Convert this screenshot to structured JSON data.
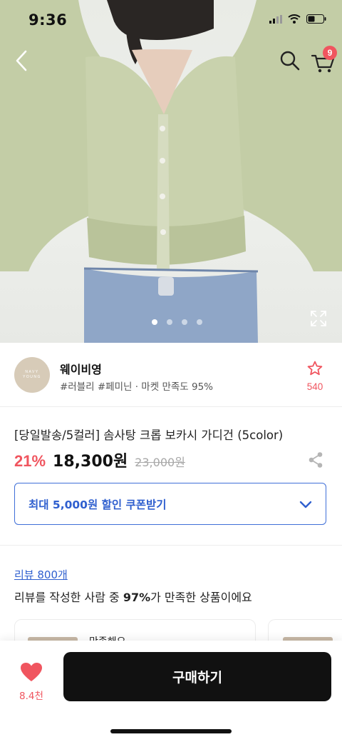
{
  "status_bar": {
    "time": "9:36"
  },
  "header": {
    "cart_count": "9"
  },
  "gallery": {
    "page_count": 4,
    "active_index": 0
  },
  "store": {
    "logo_text_line1": "NAVY",
    "logo_text_line2": "YOUNG",
    "name": "웨이비영",
    "tags": "#러블리 #페미닌 · 마켓 만족도 95%",
    "favorite_count": "540"
  },
  "product": {
    "title": "[당일발송/5컬러] 솜사탕 크롭 보카시 가디건 (5color)",
    "discount": "21%",
    "price": "18,300원",
    "original_price": "23,000원"
  },
  "coupon": {
    "label": "최대 5,000원 할인 쿠폰받기"
  },
  "reviews": {
    "link": "리뷰 800개",
    "summary_prefix": "리뷰를 작성한 사람 중 ",
    "summary_percent": "97%",
    "summary_suffix": "가 만족한 상품이에요",
    "card_text": "만족해요"
  },
  "bottom_bar": {
    "like_count": "8.4천",
    "buy_label": "구매하기"
  },
  "colors": {
    "accent_red": "#f0555f",
    "link_blue": "#2f5fcf",
    "buy_button": "#111111"
  }
}
